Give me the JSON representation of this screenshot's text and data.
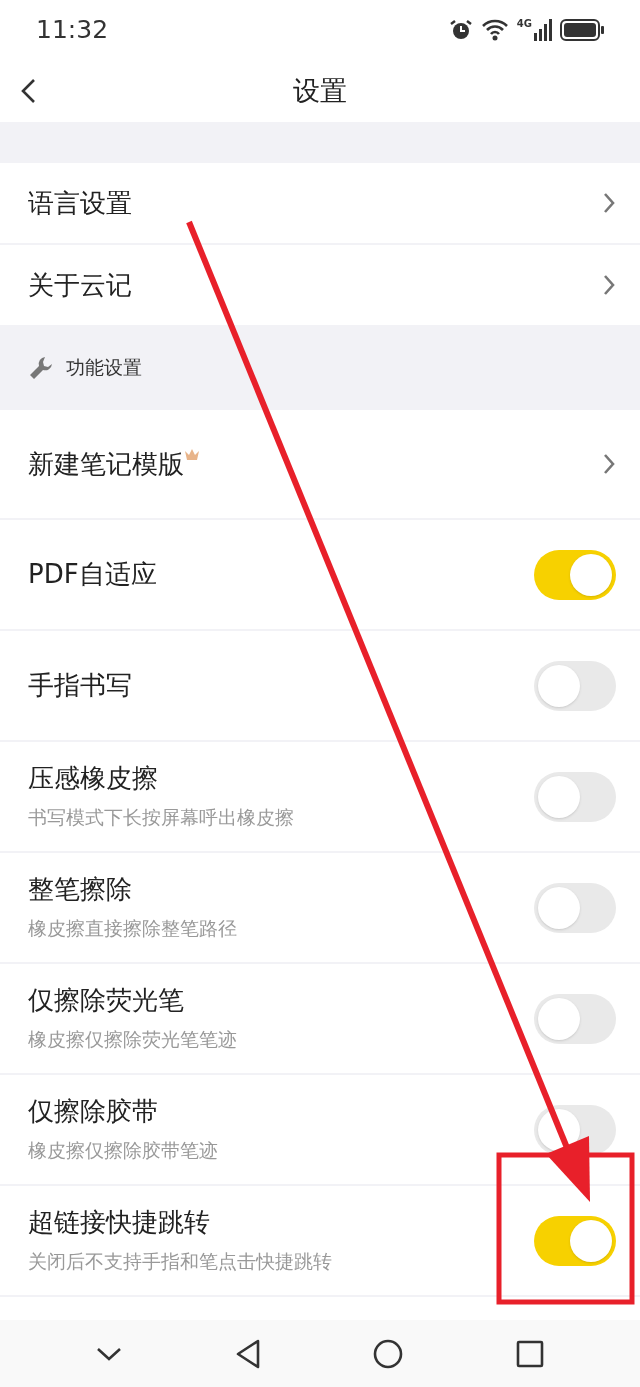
{
  "status_bar": {
    "time": "11:32",
    "network": "4G"
  },
  "header": {
    "title": "设置"
  },
  "groups": [
    {
      "items": [
        {
          "kind": "link",
          "label": "语言设置"
        },
        {
          "kind": "link",
          "label": "关于云记"
        }
      ]
    },
    {
      "section": "功能设置",
      "items": [
        {
          "kind": "link",
          "label": "新建笔记模版",
          "premium": true
        },
        {
          "kind": "toggle",
          "label": "PDF自适应",
          "on": true
        },
        {
          "kind": "toggle",
          "label": "手指书写",
          "on": false
        },
        {
          "kind": "toggle",
          "label": "压感橡皮擦",
          "subtitle": "书写模式下长按屏幕呼出橡皮擦",
          "on": false
        },
        {
          "kind": "toggle",
          "label": "整笔擦除",
          "subtitle": "橡皮擦直接擦除整笔路径",
          "on": false
        },
        {
          "kind": "toggle",
          "label": "仅擦除荧光笔",
          "subtitle": "橡皮擦仅擦除荧光笔笔迹",
          "on": false
        },
        {
          "kind": "toggle",
          "label": "仅擦除胶带",
          "subtitle": "橡皮擦仅擦除胶带笔迹",
          "on": false
        },
        {
          "kind": "toggle",
          "label": "超链接快捷跳转",
          "subtitle": "关闭后不支持手指和笔点击快捷跳转",
          "on": true
        },
        {
          "kind": "partial"
        }
      ]
    }
  ],
  "annotations": {
    "arrow": true,
    "highlight_frame": true
  }
}
